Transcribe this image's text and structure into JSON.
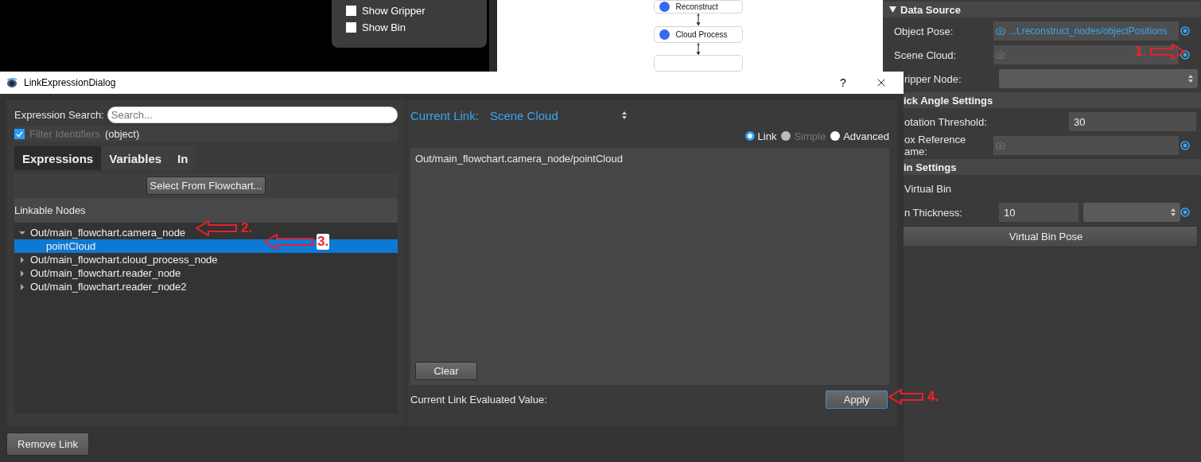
{
  "viewer": {
    "options": [
      {
        "label": "Show Gripper",
        "checked": false
      },
      {
        "label": "Show Bin",
        "checked": false
      }
    ]
  },
  "flowchart": {
    "nodes": [
      {
        "label": "Reconstruct"
      },
      {
        "label": "Cloud Process"
      }
    ]
  },
  "properties": {
    "sections": [
      {
        "title": "Data Source",
        "clipped": false,
        "rows": [
          {
            "kind": "link",
            "label": "Object Pose:",
            "clipped": false,
            "linked": true,
            "value": "...t.reconstruct_nodes/objectPositions"
          },
          {
            "kind": "link",
            "label": "Scene Cloud:",
            "clipped": false,
            "linked": false
          },
          {
            "kind": "combo",
            "label": "ripper Node:",
            "clipped": true
          }
        ]
      },
      {
        "title": "ick Angle Settings",
        "clipped": true,
        "rows": [
          {
            "kind": "number",
            "label": "otation Threshold:",
            "clipped": true,
            "value": "30"
          },
          {
            "kind": "link",
            "label": "ox Reference\name:",
            "clipped": true,
            "linked": false
          }
        ]
      },
      {
        "title": "in Settings",
        "clipped": true,
        "rows": [
          {
            "kind": "check",
            "label": "Virtual Bin",
            "clipped": true
          },
          {
            "kind": "number_unit",
            "label": "n Thickness:",
            "clipped": true,
            "value": "10"
          },
          {
            "kind": "button",
            "label": "Virtual Bin Pose"
          }
        ]
      }
    ]
  },
  "dialog": {
    "title": "LinkExpressionDialog",
    "help": "?",
    "search": {
      "label": "Expression Search:",
      "placeholder": "Search..."
    },
    "filter": {
      "label": "Filter Identifiers",
      "checked": true,
      "disabled": true,
      "value": "(object)"
    },
    "tabs": [
      {
        "label": "Expressions",
        "selected": true
      },
      {
        "label": "Variables",
        "selected": false
      },
      {
        "label": "In",
        "selected": false
      }
    ],
    "select_button": "Select From Flowchart...",
    "tree_header": "Linkable Nodes",
    "tree": [
      {
        "label": "Out/main_flowchart.camera_node",
        "selected": false,
        "expanded": true,
        "children": [
          {
            "label": "pointCloud",
            "selected": true
          }
        ]
      },
      {
        "label": "Out/main_flowchart.cloud_process_node",
        "selected": false,
        "expanded": false
      },
      {
        "label": "Out/main_flowchart.reader_node",
        "selected": false,
        "expanded": false
      },
      {
        "label": "Out/main_flowchart.reader_node2",
        "selected": false,
        "expanded": false
      }
    ],
    "current_link": {
      "label": "Current Link:",
      "value": "Scene Cloud"
    },
    "modes": [
      {
        "label": "Link",
        "selected": true,
        "disabled": false
      },
      {
        "label": "Simple",
        "selected": false,
        "disabled": true
      },
      {
        "label": "Advanced",
        "selected": false,
        "disabled": false
      }
    ],
    "expression": "Out/main_flowchart.camera_node/pointCloud",
    "clear": "Clear",
    "evaluated_label": "Current Link Evaluated Value:",
    "apply": "Apply",
    "remove": "Remove Link"
  },
  "annotations": [
    {
      "number": "1.",
      "kind": "right"
    },
    {
      "number": "2.",
      "kind": "left"
    },
    {
      "number": "3.",
      "kind": "left"
    },
    {
      "number": "4.",
      "kind": "left"
    }
  ]
}
